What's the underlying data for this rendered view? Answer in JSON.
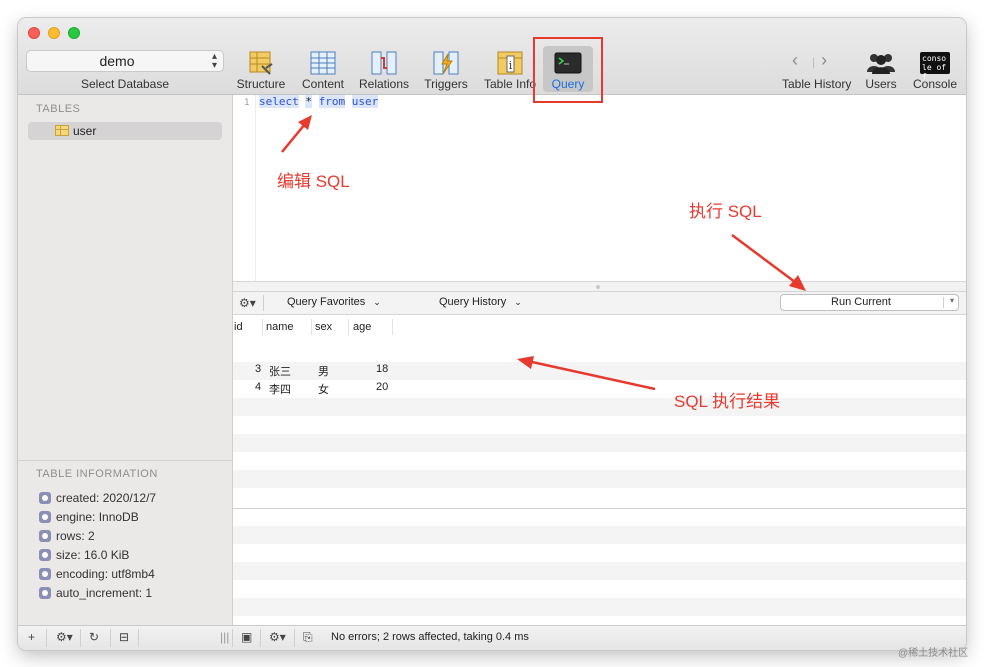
{
  "toolbar": {
    "database_value": "demo",
    "database_caption": "Select Database",
    "buttons": {
      "structure": "Structure",
      "content": "Content",
      "relations": "Relations",
      "triggers": "Triggers",
      "table_info": "Table Info",
      "query": "Query",
      "table_history": "Table History",
      "users": "Users",
      "console": "Console"
    },
    "console_icon_text": "conso le off"
  },
  "sidebar": {
    "tables_heading": "TABLES",
    "tables": [
      "user"
    ],
    "info_heading": "TABLE INFORMATION",
    "info": [
      "created: 2020/12/7",
      "engine: InnoDB",
      "rows: 2",
      "size: 16.0 KiB",
      "encoding: utf8mb4",
      "auto_increment: 1"
    ]
  },
  "editor": {
    "line_number": "1",
    "kw_select": "select",
    "star": "*",
    "kw_from": "from",
    "table": "user"
  },
  "query_bar": {
    "favorites": "Query Favorites",
    "history": "Query History",
    "run": "Run Current"
  },
  "results": {
    "columns": [
      "id",
      "name",
      "sex",
      "age"
    ],
    "rows": [
      [
        "3",
        "张三",
        "男",
        "18"
      ],
      [
        "4",
        "李四",
        "女",
        "20"
      ]
    ]
  },
  "status": {
    "message": "No errors; 2 rows affected, taking 0.4 ms"
  },
  "annotations": {
    "edit_sql": "编辑 SQL",
    "run_sql": "执行 SQL",
    "result": "SQL 执行结果"
  },
  "colors": {
    "annotation_red": "#e8392e",
    "sql_keyword": "#2c4fd6"
  },
  "watermark": "@稀土技术社区"
}
